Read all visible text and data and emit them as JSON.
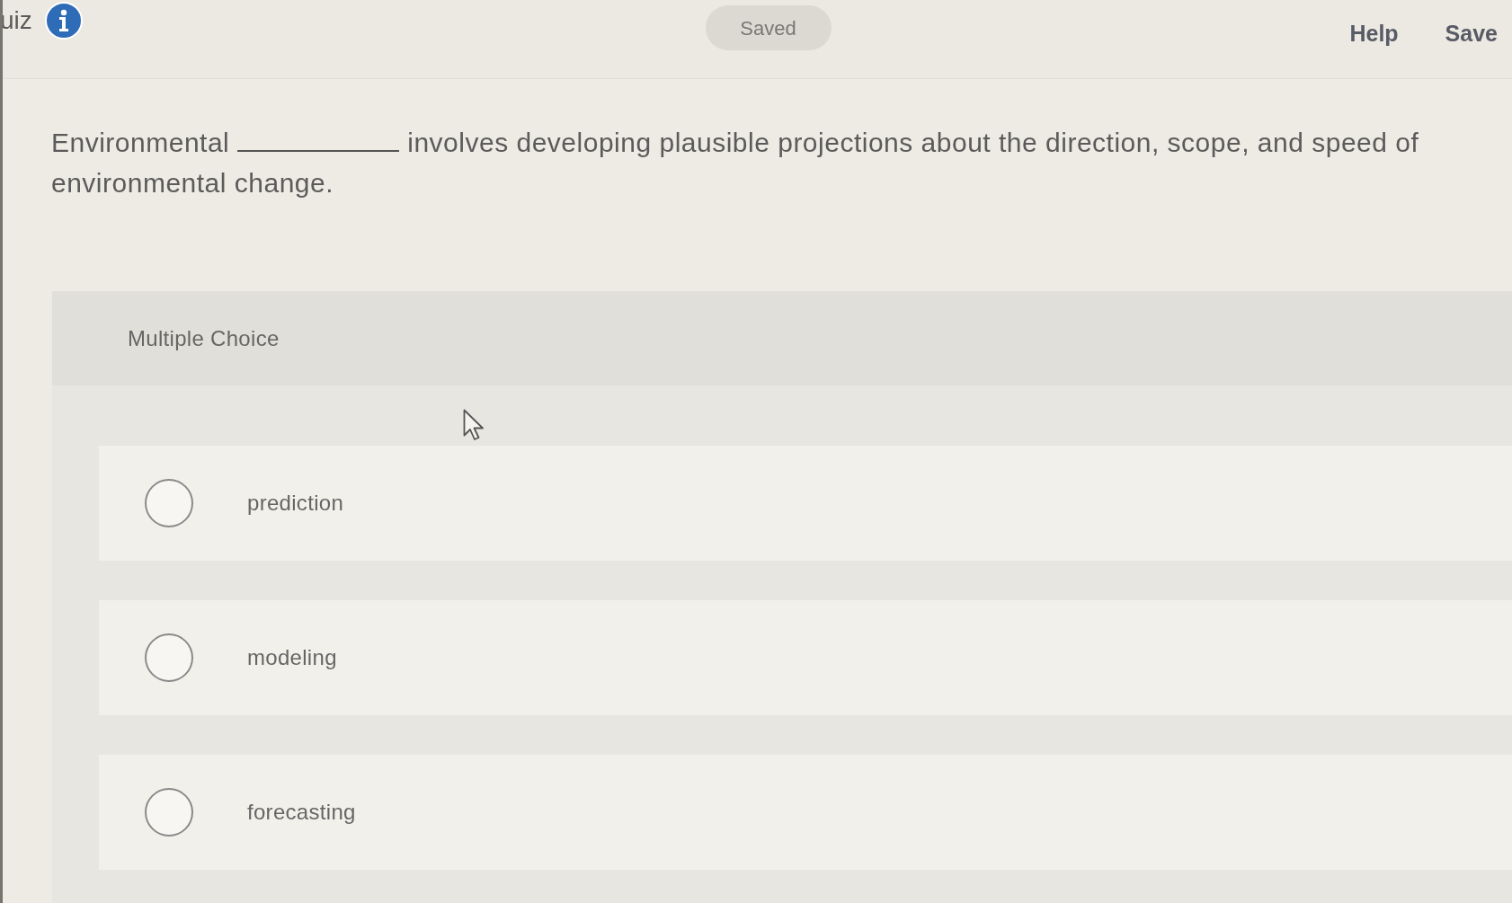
{
  "header": {
    "title": "uiz",
    "saved_status": "Saved",
    "links": [
      "Help",
      "Save"
    ]
  },
  "question": {
    "before_blank": "Environmental",
    "after_blank": "involves developing plausible projections about the direction, scope, and speed of environmental change."
  },
  "answer_panel": {
    "heading": "Multiple Choice",
    "options": [
      {
        "label": "prediction",
        "selected": false
      },
      {
        "label": "modeling",
        "selected": false
      },
      {
        "label": "forecasting",
        "selected": false
      }
    ]
  }
}
